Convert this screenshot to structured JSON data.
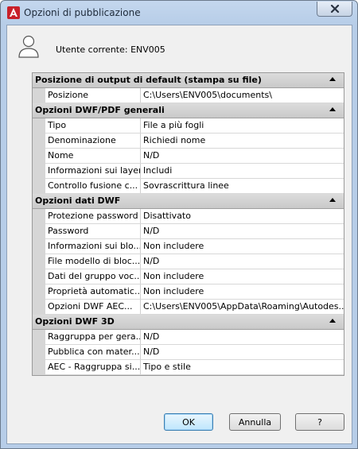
{
  "window": {
    "title": "Opzioni di pubblicazione"
  },
  "user": {
    "label": "Utente corrente: ENV005"
  },
  "sections": [
    {
      "title": "Posizione di output di default (stampa su file)",
      "rows": [
        {
          "name": "Posizione",
          "value": "C:\\Users\\ENV005\\documents\\"
        }
      ]
    },
    {
      "title": "Opzioni DWF/PDF generali",
      "rows": [
        {
          "name": "Tipo",
          "value": "File a più fogli"
        },
        {
          "name": "Denominazione",
          "value": "Richiedi nome"
        },
        {
          "name": "Nome",
          "value": "N/D"
        },
        {
          "name": "Informazioni sui layer",
          "value": "Includi"
        },
        {
          "name": "Controllo fusione c...",
          "value": "Sovrascrittura linee"
        }
      ]
    },
    {
      "title": "Opzioni dati DWF",
      "rows": [
        {
          "name": "Protezione password",
          "value": "Disattivato"
        },
        {
          "name": "Password",
          "value": "N/D"
        },
        {
          "name": "Informazioni sui blo...",
          "value": "Non includere"
        },
        {
          "name": "File modello di bloc...",
          "value": "N/D"
        },
        {
          "name": "Dati del gruppo voc...",
          "value": "Non includere"
        },
        {
          "name": "Proprietà automatic...",
          "value": "Non includere"
        },
        {
          "name": "Opzioni DWF AEC...",
          "value": "C:\\Users\\ENV005\\AppData\\Roaming\\Autodes..."
        }
      ]
    },
    {
      "title": "Opzioni DWF 3D",
      "rows": [
        {
          "name": "Raggruppa per gera...",
          "value": "N/D"
        },
        {
          "name": "Pubblica con mater...",
          "value": "N/D"
        },
        {
          "name": "AEC - Raggruppa si...",
          "value": "Tipo e stile"
        }
      ]
    }
  ],
  "buttons": {
    "ok": "OK",
    "cancel": "Annulla",
    "help": "?"
  }
}
